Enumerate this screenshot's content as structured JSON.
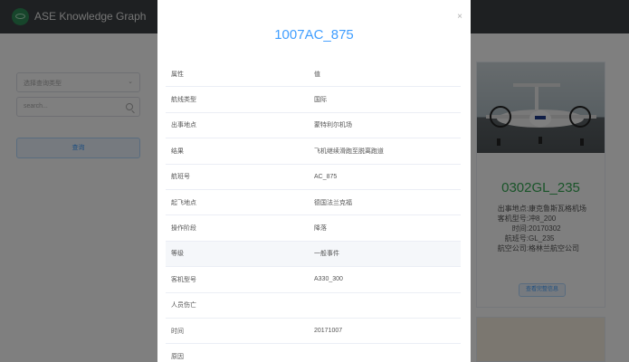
{
  "app": {
    "title": "ASE Knowledge Graph"
  },
  "left_panel": {
    "select_placeholder": "选择查询类型",
    "search_placeholder": "search...",
    "query_button": "查询"
  },
  "card": {
    "title": "0302GL_235",
    "fields": [
      {
        "label": "出事地点:",
        "value": "康克鲁斯瓦格机场"
      },
      {
        "label": "客机型号:",
        "value": "冲8_200"
      },
      {
        "label": "时间:",
        "value": "20170302"
      },
      {
        "label": "航班号:",
        "value": "GL_235"
      },
      {
        "label": "航空公司:",
        "value": "格林兰航空公司"
      }
    ],
    "detail_button": "查看完整信息"
  },
  "dialog": {
    "title": "1007AC_875",
    "rows": [
      {
        "key": "属性",
        "value": "值"
      },
      {
        "key": "航线类型",
        "value": "国际"
      },
      {
        "key": "出事地点",
        "value": "蒙特利尔机场"
      },
      {
        "key": "结果",
        "value": "飞机继续滑跑至脱离跑道"
      },
      {
        "key": "航班号",
        "value": "AC_875"
      },
      {
        "key": "起飞地点",
        "value": "德国法兰克福"
      },
      {
        "key": "操作阶段",
        "value": "降落"
      },
      {
        "key": "等级",
        "value": "一般事件"
      },
      {
        "key": "客机型号",
        "value": "A330_300"
      },
      {
        "key": "人员伤亡",
        "value": ""
      },
      {
        "key": "时间",
        "value": "20171007"
      },
      {
        "key": "原因",
        "value": ""
      }
    ]
  },
  "icons": {
    "close": "×",
    "chevron": "⌄"
  }
}
